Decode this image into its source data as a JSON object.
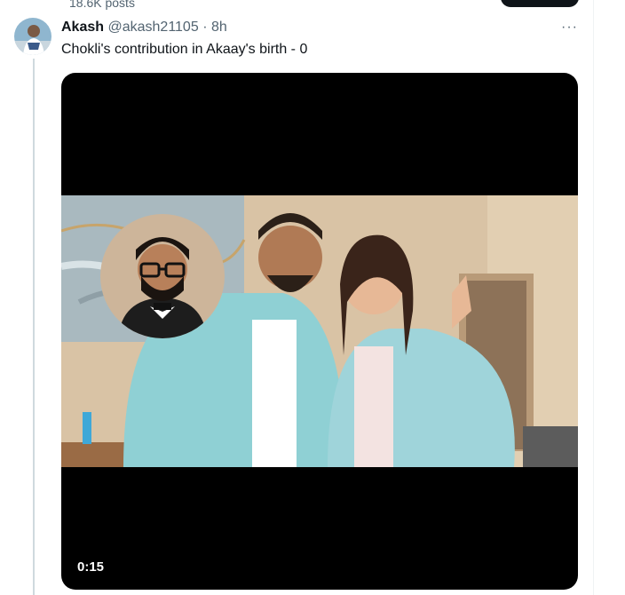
{
  "profile_header": {
    "posts_count": "18.6K posts"
  },
  "tweet": {
    "author_name": "Akash",
    "handle": "@akash21105",
    "separator": "·",
    "time": "8h",
    "more_label": "···",
    "text": "Chokli's contribution in Akaay's birth - 0"
  },
  "video": {
    "duration": "0:15"
  },
  "colors": {
    "text": "#0f1419",
    "muted": "#536471",
    "thread_line": "#cfd9de",
    "video_bg": "#000000"
  },
  "icons": {
    "more": "more-dots-icon"
  }
}
